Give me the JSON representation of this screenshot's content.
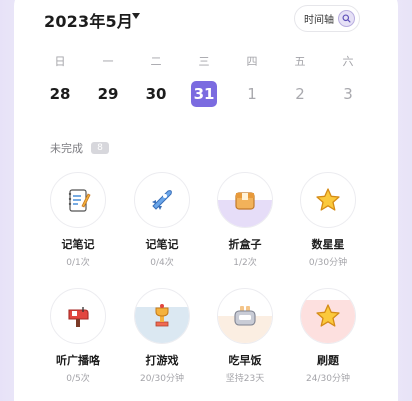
{
  "header": {
    "month_title": "2023年5月",
    "timeline_label": "时间轴"
  },
  "calendar": {
    "weekdays": [
      "日",
      "一",
      "二",
      "三",
      "四",
      "五",
      "六"
    ],
    "dates": [
      "28",
      "29",
      "30",
      "31",
      "1",
      "2",
      "3"
    ],
    "selected_index": 3
  },
  "section": {
    "title": "未完成",
    "count": "8"
  },
  "colors": {
    "accent": "#7b6be0",
    "progress_purple": "#e6ddf8",
    "progress_blue": "#dbe8f2",
    "progress_orange": "#fbeee2",
    "progress_red": "#fde0df"
  },
  "tasks": [
    {
      "name": "记笔记",
      "progress": "0/1次",
      "icon": "notebook-icon",
      "fill_fraction": 0,
      "fill_color": "#e6ddf8"
    },
    {
      "name": "记笔记",
      "progress": "0/4次",
      "icon": "rocket-icon",
      "fill_fraction": 0,
      "fill_color": "#e6ddf8"
    },
    {
      "name": "折盒子",
      "progress": "1/2次",
      "icon": "box-icon",
      "fill_fraction": 0.5,
      "fill_color": "#e6ddf8"
    },
    {
      "name": "数星星",
      "progress": "0/30分钟",
      "icon": "star-icon",
      "fill_fraction": 0,
      "fill_color": "#e6ddf8"
    },
    {
      "name": "听广播咯",
      "progress": "0/5次",
      "icon": "mailbox-icon",
      "fill_fraction": 0,
      "fill_color": "#e6ddf8"
    },
    {
      "name": "打游戏",
      "progress": "20/30分钟",
      "icon": "trophy-icon",
      "fill_fraction": 0.67,
      "fill_color": "#dbe8f2"
    },
    {
      "name": "吃早饭",
      "progress": "坚持23天",
      "icon": "toaster-icon",
      "fill_fraction": 0.5,
      "fill_color": "#fbeee2"
    },
    {
      "name": "刷题",
      "progress": "24/30分钟",
      "icon": "star-icon",
      "fill_fraction": 0.8,
      "fill_color": "#fde0df"
    }
  ]
}
